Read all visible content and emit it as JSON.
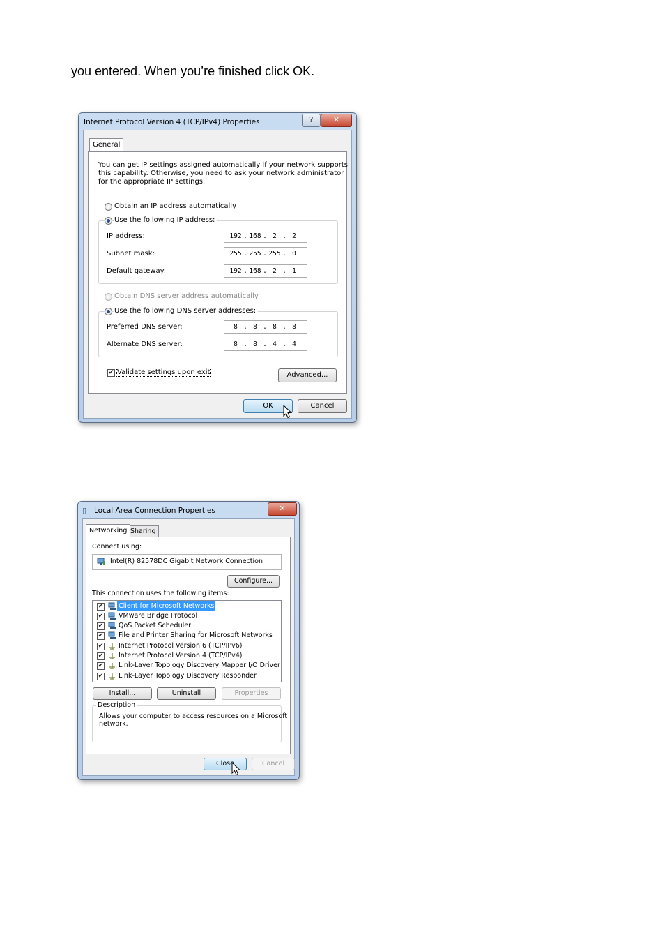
{
  "intro_text": "you entered. When you’re finished click OK.",
  "ipv4_dialog": {
    "title": "Internet Protocol Version 4 (TCP/IPv4) Properties",
    "help_label": "?",
    "close_label": "✕",
    "tab": "General",
    "description": [
      "You can get IP settings assigned automatically if your network supports",
      "this capability. Otherwise, you need to ask your network administrator",
      "for the appropriate IP settings."
    ],
    "radio_auto_ip": "Obtain an IP address automatically",
    "radio_manual_ip": "Use the following IP address:",
    "ip_label": "IP address:",
    "ip_value": [
      "192",
      "168",
      "2",
      "2"
    ],
    "subnet_label": "Subnet mask:",
    "subnet_value": [
      "255",
      "255",
      "255",
      "0"
    ],
    "gateway_label": "Default gateway:",
    "gateway_value": [
      "192",
      "168",
      "2",
      "1"
    ],
    "radio_auto_dns": "Obtain DNS server address automatically",
    "radio_manual_dns": "Use the following DNS server addresses:",
    "preferred_dns_label": "Preferred DNS server:",
    "preferred_dns_value": [
      "8",
      "8",
      "8",
      "8"
    ],
    "alternate_dns_label": "Alternate DNS server:",
    "alternate_dns_value": [
      "8",
      "8",
      "4",
      "4"
    ],
    "validate_label": "Validate settings upon exit",
    "advanced_label": "Advanced...",
    "ok_label": "OK",
    "cancel_label": "Cancel"
  },
  "lan_dialog": {
    "title": "Local Area Connection Properties",
    "close_label": "✕",
    "tabs": [
      "Networking",
      "Sharing"
    ],
    "connect_using_label": "Connect using:",
    "adapter_name": "Intel(R) 82578DC Gigabit Network Connection",
    "configure_label": "Configure...",
    "items_label": "This connection uses the following items:",
    "items": [
      "Client for Microsoft Networks",
      "VMware Bridge Protocol",
      "QoS Packet Scheduler",
      "File and Printer Sharing for Microsoft Networks",
      "Internet Protocol Version 6 (TCP/IPv6)",
      "Internet Protocol Version 4 (TCP/IPv4)",
      "Link-Layer Topology Discovery Mapper I/O Driver",
      "Link-Layer Topology Discovery Responder"
    ],
    "install_label": "Install...",
    "uninstall_label": "Uninstall",
    "properties_label": "Properties",
    "description_heading": "Description",
    "description_text": [
      "Allows your computer to access resources on a Microsoft",
      "network."
    ],
    "close_button_label": "Close",
    "cancel_label": "Cancel"
  },
  "colors": {
    "selection": "#3399ff",
    "title_gradient_top": "#c9dcf1",
    "close_red": "#c7472f"
  }
}
